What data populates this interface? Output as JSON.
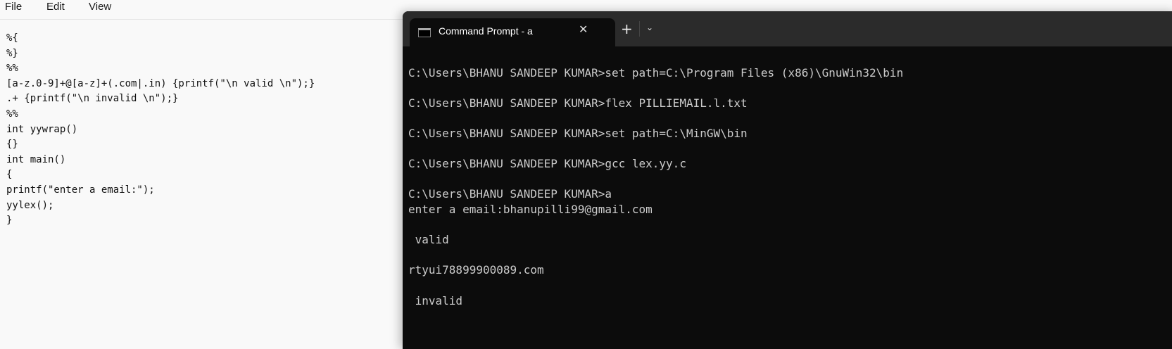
{
  "notepad": {
    "menu": [
      "File",
      "Edit",
      "View"
    ],
    "lines": [
      "%{",
      "%}",
      "%%",
      "[a-z.0-9]+@[a-z]+(.com|.in) {printf(\"\\n valid \\n\");}",
      ".+ {printf(\"\\n invalid \\n\");}",
      "%%",
      "int yywrap()",
      "{}",
      "int main()",
      "{",
      "printf(\"enter a email:\");",
      "yylex();",
      "}"
    ]
  },
  "terminal": {
    "tab_title": "Command Prompt - a",
    "close_glyph": "✕",
    "new_tab_glyph": "+",
    "dropdown_glyph": "⌄",
    "lines": [
      "",
      "C:\\Users\\BHANU SANDEEP KUMAR>set path=C:\\Program Files (x86)\\GnuWin32\\bin",
      "",
      "C:\\Users\\BHANU SANDEEP KUMAR>flex PILLIEMAIL.l.txt",
      "",
      "C:\\Users\\BHANU SANDEEP KUMAR>set path=C:\\MinGW\\bin",
      "",
      "C:\\Users\\BHANU SANDEEP KUMAR>gcc lex.yy.c",
      "",
      "C:\\Users\\BHANU SANDEEP KUMAR>a",
      "enter a email:bhanupilli99@gmail.com",
      "",
      " valid",
      "",
      "rtyui78899900089.com",
      "",
      " invalid"
    ]
  }
}
